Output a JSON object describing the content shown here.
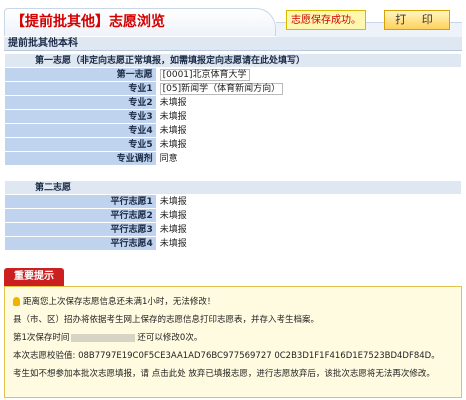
{
  "header": {
    "title": "【提前批其他】志愿浏览",
    "save_message": "志愿保存成功。",
    "print_label": "打 印"
  },
  "section": {
    "title": "提前批其他本科"
  },
  "group1": {
    "heading": "第一志愿（非定向志愿正常填报，如需填报定向志愿请在此处填写）",
    "rows": [
      {
        "label": "第一志愿",
        "value": "[0001]北京体育大学"
      },
      {
        "label": "专业1",
        "value": "[05]新闻学（体育新闻方向）"
      },
      {
        "label": "专业2",
        "value": "未填报"
      },
      {
        "label": "专业3",
        "value": "未填报"
      },
      {
        "label": "专业4",
        "value": "未填报"
      },
      {
        "label": "专业5",
        "value": "未填报"
      },
      {
        "label": "专业调剂",
        "value": "同意"
      }
    ]
  },
  "group2": {
    "heading": "第二志愿",
    "rows": [
      {
        "label": "平行志愿1",
        "value": "未填报"
      },
      {
        "label": "平行志愿2",
        "value": "未填报"
      },
      {
        "label": "平行志愿3",
        "value": "未填报"
      },
      {
        "label": "平行志愿4",
        "value": "未填报"
      }
    ]
  },
  "notice": {
    "title": "重要提示",
    "line1": "距离您上次保存志愿信息还未满1小时，无法修改！",
    "line2": "县（市、区）招办将依据考生网上保存的志愿信息打印志愿表，并存入考生档案。",
    "line3_prefix": "第1次保存时间",
    "line3_suffix": "还可以修改0次。",
    "line4_label": "本次志愿校验值:",
    "line4_value": "08B7797E19C0F5CE3AA1AD76BC977569727 0C2B3D1F1F416D1E7523BD4DF84D。",
    "line5": "考生如不想参加本批次志愿填报，请 点击此处 放弃已填报志愿，进行志愿放弃后，该批次志愿将无法再次修改。"
  }
}
